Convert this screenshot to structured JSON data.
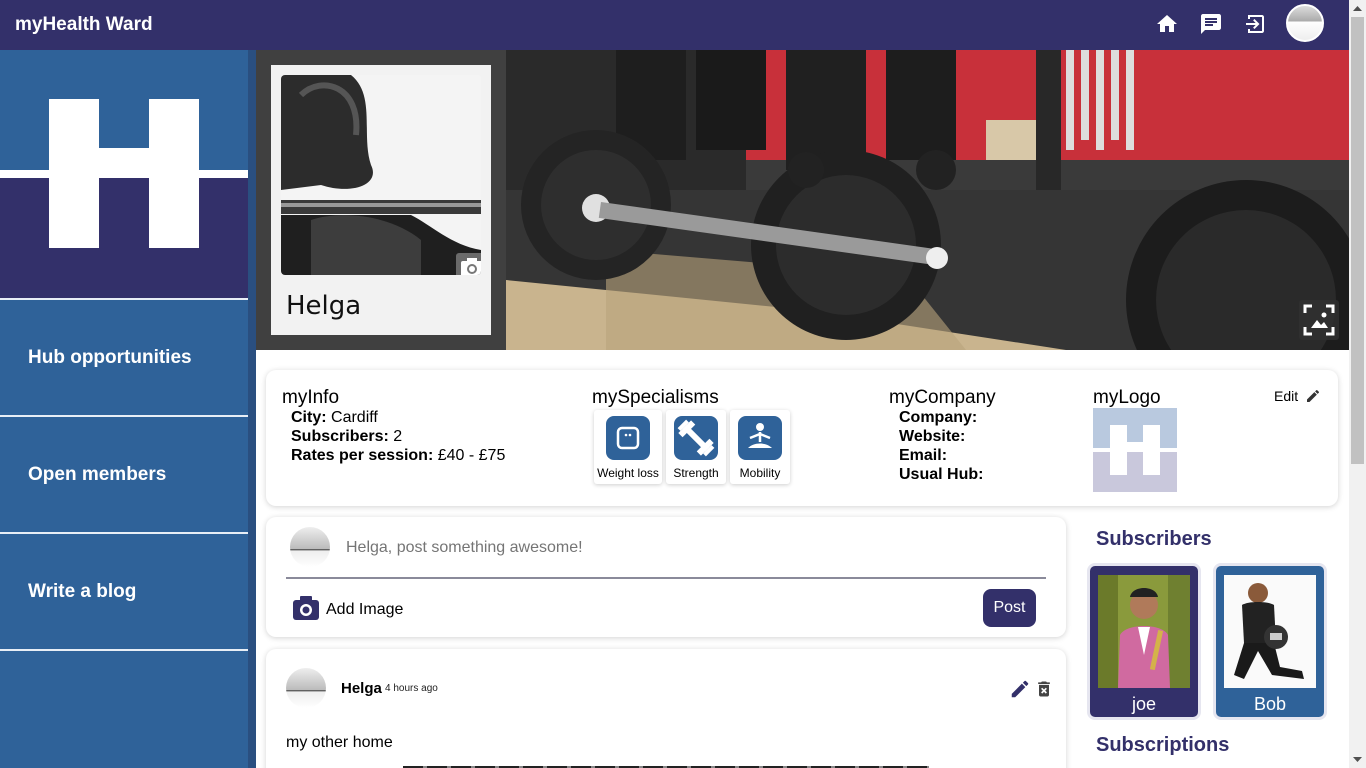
{
  "app": {
    "title": "myHealth Ward"
  },
  "topbar": {
    "icons": [
      "home-icon",
      "chat-icon",
      "logout-icon"
    ],
    "avatar": "user-avatar"
  },
  "sidebar": {
    "items": [
      {
        "label": "Hub opportunities"
      },
      {
        "label": "Open members"
      },
      {
        "label": "Write a blog"
      }
    ]
  },
  "profile": {
    "name": "Helga"
  },
  "info": {
    "title": "myInfo",
    "city_label": "City:",
    "city": "Cardiff",
    "subscribers_label": "Subscribers:",
    "subscribers": "2",
    "rates_label": "Rates per session:",
    "rates": "£40 - £75"
  },
  "specialisms": {
    "title": "mySpecialisms",
    "items": [
      {
        "label": "Weight loss",
        "icon": "scale-icon"
      },
      {
        "label": "Strength",
        "icon": "dumbbell-icon"
      },
      {
        "label": "Mobility",
        "icon": "meditation-icon"
      }
    ]
  },
  "company": {
    "title": "myCompany",
    "company_label": "Company:",
    "website_label": "Website:",
    "email_label": "Email:",
    "hub_label": "Usual Hub:"
  },
  "logo": {
    "title": "myLogo",
    "edit_label": "Edit"
  },
  "composer": {
    "placeholder": "Helga, post something awesome!",
    "add_image_label": "Add Image",
    "post_label": "Post"
  },
  "post": {
    "author": "Helga",
    "time": "4 hours ago",
    "body": "my other home"
  },
  "subscribers": {
    "title": "Subscribers",
    "items": [
      {
        "name": "joe",
        "card_color": "#33306a"
      },
      {
        "name": "Bob",
        "card_color": "#2f6299"
      }
    ]
  },
  "subscriptions": {
    "title": "Subscriptions"
  },
  "colors": {
    "primary": "#33306a",
    "secondary": "#2f6299"
  }
}
